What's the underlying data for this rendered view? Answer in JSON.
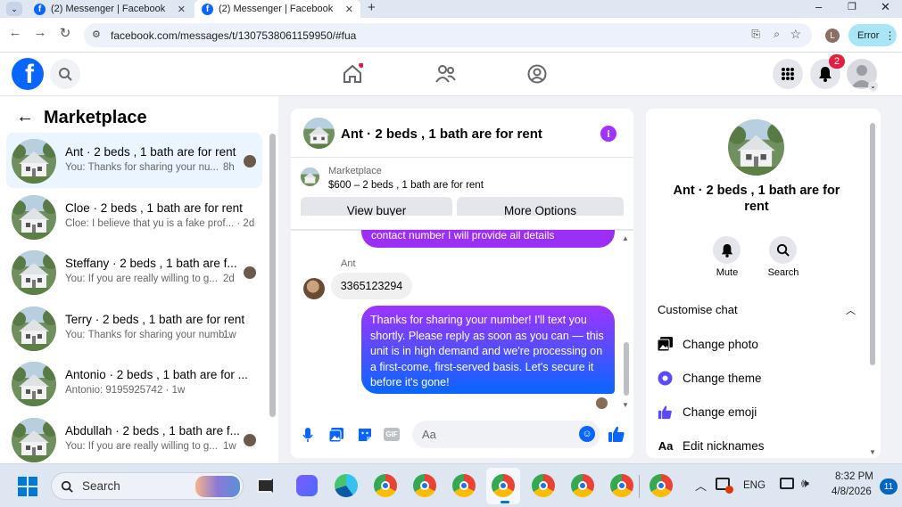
{
  "browser": {
    "tabs": [
      {
        "title": "(2) Messenger | Facebook",
        "active": false
      },
      {
        "title": "(2) Messenger | Facebook",
        "active": true
      }
    ],
    "url": "facebook.com/messages/t/1307538061159950/#fua",
    "profile_initial": "L",
    "error_label": "Error"
  },
  "fb": {
    "logo_letter": "f",
    "notification_count": "2"
  },
  "sidebar": {
    "title": "Marketplace",
    "conversations": [
      {
        "title": "Ant · 2 beds , 1 bath are for rent",
        "snippet": "You: Thanks for sharing your nu...",
        "time": "8h",
        "active": true
      },
      {
        "title": "Cloe · 2 beds , 1 bath are for rent",
        "snippet": "Cloe: I believe that yu is a fake prof... · 2d",
        "time": "",
        "active": false
      },
      {
        "title": "Steffany · 2 beds , 1 bath are f...",
        "snippet": "You: If you are really willing to g...",
        "time": "2d",
        "active": false
      },
      {
        "title": "Terry · 2 beds , 1 bath are for rent",
        "snippet": "You: Thanks for sharing your numb...",
        "time": "1w",
        "active": false
      },
      {
        "title": "Antonio · 2 beds , 1 bath are for ...",
        "snippet": "Antonio: 9195925742 · 1w",
        "time": "",
        "active": false
      },
      {
        "title": "Abdullah · 2 beds , 1 bath are f...",
        "snippet": "You: If you are really willing to g...",
        "time": "1w",
        "active": false
      }
    ]
  },
  "chat": {
    "title": "Ant · 2 beds , 1 bath are for rent",
    "listing_label": "Marketplace",
    "listing_price": "$600 – 2 beds , 1 bath are for rent",
    "view_buyer": "View buyer",
    "more_options": "More Options",
    "partial_message": "contact number I will provide all  details",
    "sender_name": "Ant",
    "incoming_message": "3365123294",
    "outgoing_message": "Thanks for sharing your number! I'll text you shortly. Please reply as soon as you can — this unit is in high demand and we're processing on a first-come, first-served basis. Let's secure it before it's gone!",
    "composer_placeholder": "Aa"
  },
  "info": {
    "title": "Ant · 2 beds , 1 bath are for rent",
    "mute_label": "Mute",
    "search_label": "Search",
    "section_title": "Customise chat",
    "items": [
      "Change photo",
      "Change theme",
      "Change emoji",
      "Edit nicknames"
    ]
  },
  "taskbar": {
    "search_placeholder": "Search",
    "language": "ENG",
    "time": "8:32 PM",
    "date": "4/8/2026",
    "notification_count": "11"
  },
  "colors": {
    "fb_blue": "#0866ff",
    "accent_purple": "#a033ff",
    "badge_red": "#e41e3f"
  }
}
